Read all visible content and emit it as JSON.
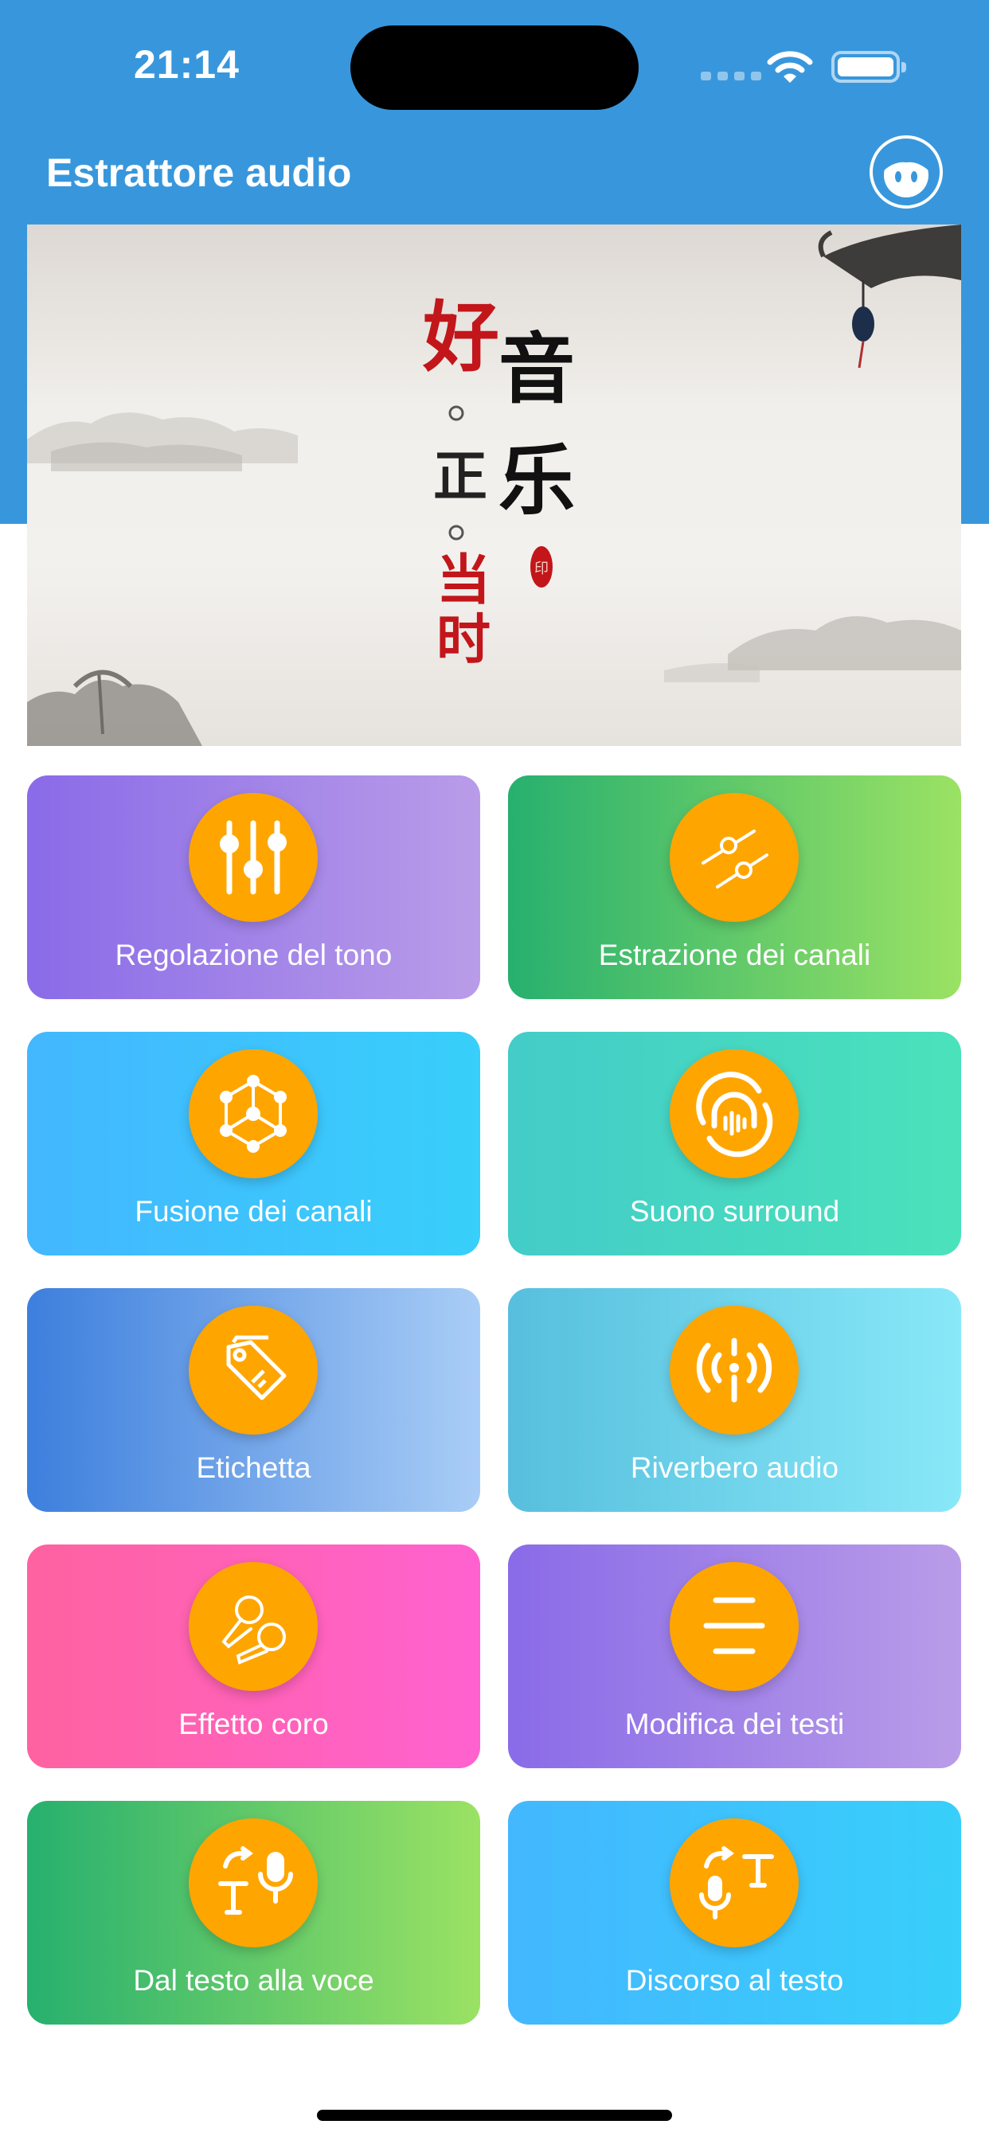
{
  "status_bar": {
    "time": "21:14"
  },
  "header": {
    "title": "Estrattore audio"
  },
  "banner": {
    "line1": [
      "好",
      "正",
      "当",
      "时"
    ],
    "line2": [
      "音",
      "乐"
    ],
    "seal_text": "印"
  },
  "features": [
    {
      "label": "Regolazione del tono",
      "icon": "equalizer-sliders-icon",
      "colors": [
        "#8a6be8",
        "#b99ce8"
      ]
    },
    {
      "label": "Estrazione dei canali",
      "icon": "channel-split-icon",
      "colors": [
        "#27b06f",
        "#9be264"
      ]
    },
    {
      "label": "Fusione dei canali",
      "icon": "cube-network-icon",
      "colors": [
        "#43b7ff",
        "#38cffa"
      ]
    },
    {
      "label": "Suono surround",
      "icon": "surround-headphones-icon",
      "colors": [
        "#43ccc8",
        "#4ae2bb"
      ]
    },
    {
      "label": "Etichetta",
      "icon": "tag-icon",
      "colors": [
        "#3d7fdd",
        "#a9cdf6"
      ]
    },
    {
      "label": "Riverbero audio",
      "icon": "broadcast-icon",
      "colors": [
        "#57bfdd",
        "#88e8f8"
      ]
    },
    {
      "label": "Effetto coro",
      "icon": "microphones-icon",
      "colors": [
        "#ff62a0",
        "#ff62cf"
      ]
    },
    {
      "label": "Modifica dei testi",
      "icon": "lines-icon",
      "colors": [
        "#8a6be8",
        "#b99ce8"
      ]
    },
    {
      "label": "Dal testo alla voce",
      "icon": "text-to-speech-icon",
      "colors": [
        "#27b06f",
        "#9be264"
      ]
    },
    {
      "label": "Discorso al testo",
      "icon": "speech-to-text-icon",
      "colors": [
        "#43b7ff",
        "#38cffa"
      ]
    }
  ],
  "icon_color": "#ffa500",
  "header_color": "#3897dc"
}
